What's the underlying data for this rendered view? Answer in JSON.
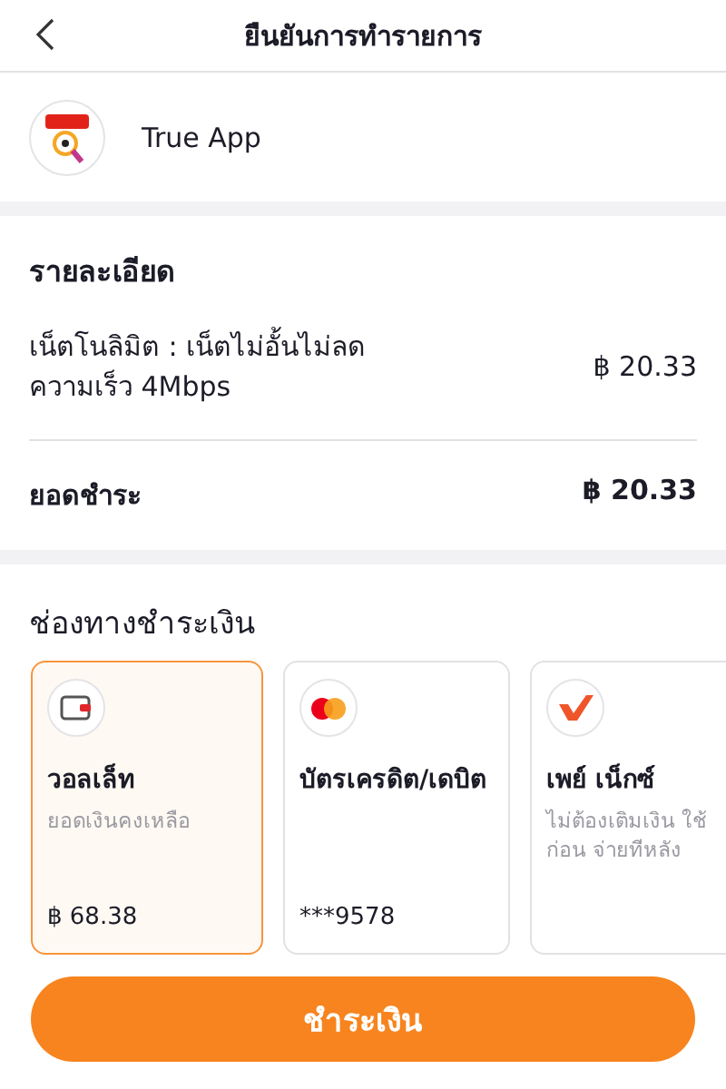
{
  "header": {
    "title": "ยืนยันการทำรายการ"
  },
  "merchant": {
    "name": "True App"
  },
  "details": {
    "title": "รายละเอียด",
    "items": [
      {
        "label": "เน็ตโนลิมิต : เน็ตไม่อั้นไม่ลดความเร็ว 4Mbps",
        "amount": "฿ 20.33"
      }
    ],
    "total_label": "ยอดชำระ",
    "total": "฿ 20.33"
  },
  "payment": {
    "title": "ช่องทางชำระเงิน",
    "methods": [
      {
        "kind": "wallet",
        "name": "วอลเล็ท",
        "note": "ยอดเงินคงเหลือ",
        "value": "฿ 68.38",
        "selected": true
      },
      {
        "kind": "card",
        "name": "บัตรเครดิต/เดบิต",
        "value": "***9578",
        "selected": false
      },
      {
        "kind": "paylater",
        "name": "เพย์ เน็กซ์",
        "note": "ไม่ต้องเติมเงิน ใช้ก่อน จ่ายทีหลัง",
        "selected": false
      }
    ]
  },
  "pay_button": "ชำระเงิน"
}
